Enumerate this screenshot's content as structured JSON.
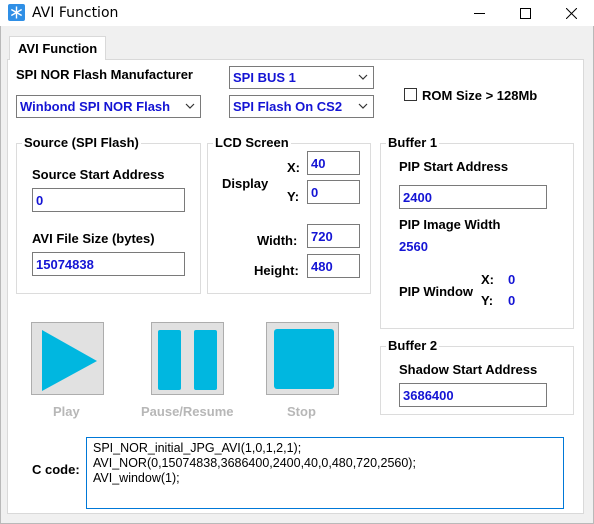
{
  "window": {
    "title": "AVI Function",
    "minimize_icon": "minimize-icon",
    "maximize_icon": "maximize-icon",
    "close_icon": "close-icon"
  },
  "tab": {
    "label": "AVI Function"
  },
  "flash": {
    "manufacturer_label": "SPI NOR Flash Manufacturer",
    "manufacturer_value": "Winbond SPI NOR Flash",
    "bus_value": "SPI BUS 1",
    "cs_value": "SPI Flash On CS2",
    "rom_size_label": "ROM Size > 128Mb",
    "rom_size_checked": false
  },
  "source": {
    "group_title": "Source (SPI Flash)",
    "start_address_label": "Source Start Address",
    "start_address_value": "0",
    "file_size_label": "AVI File Size (bytes)",
    "file_size_value": "15074838"
  },
  "lcd": {
    "group_title": "LCD Screen",
    "display_label": "Display",
    "x_label": "X:",
    "x_value": "40",
    "y_label": "Y:",
    "y_value": "0",
    "width_label": "Width:",
    "width_value": "720",
    "height_label": "Height:",
    "height_value": "480"
  },
  "buffer1": {
    "group_title": "Buffer 1",
    "pip_start_label": "PIP Start Address",
    "pip_start_value": "2400",
    "pip_width_label": "PIP Image Width",
    "pip_width_value": "2560",
    "pip_window_label": "PIP Window",
    "x_label": "X:",
    "x_value": "0",
    "y_label": "Y:",
    "y_value": "0"
  },
  "buffer2": {
    "group_title": "Buffer 2",
    "shadow_label": "Shadow Start Address",
    "shadow_value": "3686400"
  },
  "controls": {
    "play_label": "Play",
    "pause_label": "Pause/Resume",
    "stop_label": "Stop",
    "accent_color": "#00b7e0"
  },
  "code": {
    "label": "C code:",
    "lines": [
      "SPI_NOR_initial_JPG_AVI(1,0,1,2,1);",
      "AVI_NOR(0,15074838,3686400,2400,40,0,480,720,2560);",
      "AVI_window(1);"
    ]
  }
}
